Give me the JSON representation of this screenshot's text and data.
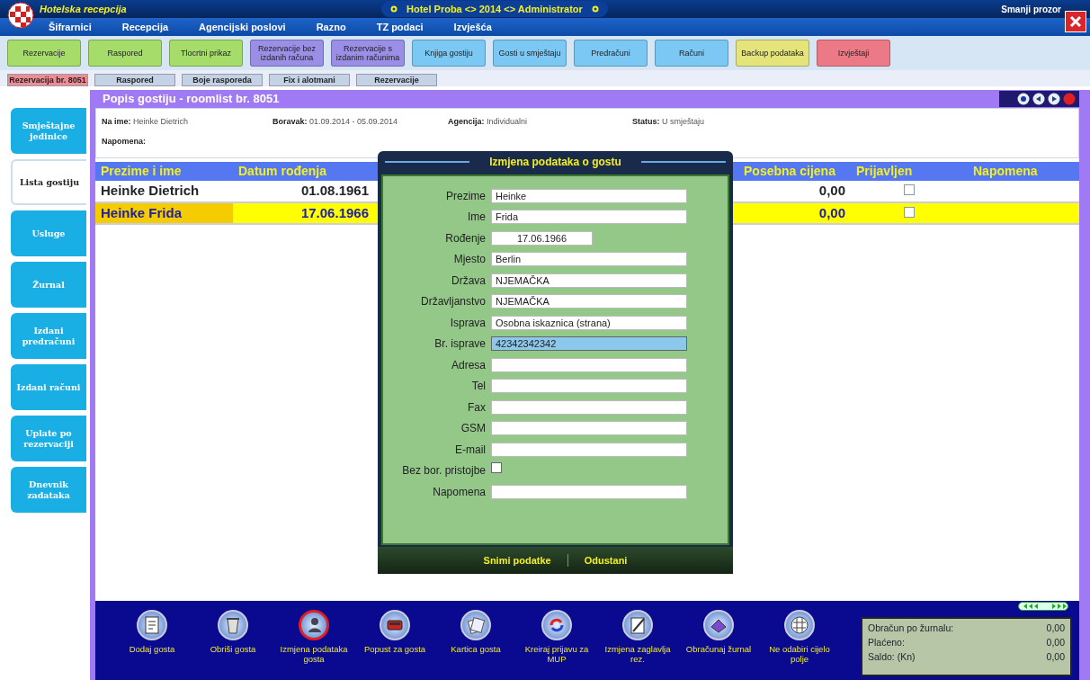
{
  "window": {
    "app_title": "Hotelska recepcija",
    "context": "Hotel Proba <> 2014 <> Administrator",
    "minimize": "Smanji prozor"
  },
  "menu": [
    "Šifrarnici",
    "Recepcija",
    "Agencijski poslovi",
    "Razno",
    "TZ podaci",
    "Izvješća"
  ],
  "toolbar": [
    {
      "label": "Rezervacije",
      "color": "#a6dc6a"
    },
    {
      "label": "Raspored",
      "color": "#a6dc6a"
    },
    {
      "label": "Tlocrtni prikaz",
      "color": "#a6dc6a"
    },
    {
      "label": "Rezervacije bez izdanih računa",
      "color": "#9a8ee6"
    },
    {
      "label": "Rezervacije s izdanim računima",
      "color": "#9a8ee6"
    },
    {
      "label": "Knjiga gostiju",
      "color": "#7cc8f4"
    },
    {
      "label": "Gosti u smještaju",
      "color": "#7cc8f4"
    },
    {
      "label": "Predračuni",
      "color": "#7cc8f4"
    },
    {
      "label": "Računi",
      "color": "#7cc8f4"
    },
    {
      "label": "Backup podataka",
      "color": "#e4e47a"
    },
    {
      "label": "Izvještaji",
      "color": "#ec7a86"
    }
  ],
  "tabs": [
    {
      "label": "Rezervacija br. 8051",
      "selected": true
    },
    {
      "label": "Raspored",
      "selected": false
    },
    {
      "label": "Boje rasporeda",
      "selected": false
    },
    {
      "label": "Fix i alotmani",
      "selected": false
    },
    {
      "label": "Rezervacije",
      "selected": false
    }
  ],
  "sidebar": {
    "items": [
      {
        "label": "Smještajne jedinice",
        "selected": false
      },
      {
        "label": "Lista gostiju",
        "selected": true
      },
      {
        "label": "Usluge",
        "selected": false
      },
      {
        "label": "Žurnal",
        "selected": false
      },
      {
        "label": "Izdani predračuni",
        "selected": false
      },
      {
        "label": "Izdani računi",
        "selected": false
      },
      {
        "label": "Uplate po rezervaciji",
        "selected": false
      },
      {
        "label": "Dnevnik zadataka",
        "selected": false
      }
    ]
  },
  "panel": {
    "title": "Popis gostiju - roomlist br. 8051",
    "info": [
      {
        "label": "Na ime:",
        "value": "Heinke Dietrich"
      },
      {
        "label": "Boravak:",
        "value": "01.09.2014 - 05.09.2014"
      },
      {
        "label": "Agencija:",
        "value": "Individualni"
      },
      {
        "label": "Status:",
        "value": "U smještaju"
      },
      {
        "label": "Napomena:"
      }
    ]
  },
  "table": {
    "columns": [
      "Prezime i ime",
      "Datum rođenja",
      "Posebna cijena",
      "Prijavljen",
      "Napomena"
    ],
    "rows": [
      {
        "name": "Heinke Dietrich",
        "birth_date": "01.08.1961",
        "special_price": "0,00",
        "registered": false,
        "selected": false
      },
      {
        "name": "Heinke Frida",
        "birth_date": "17.06.1966",
        "special_price": "0,00",
        "registered": false,
        "selected": true
      }
    ]
  },
  "dialog": {
    "title": "Izmjena podataka o gostu",
    "fields": [
      {
        "label": "Prezime",
        "kind": "text",
        "value": "Heinke",
        "focused": false
      },
      {
        "label": "Ime",
        "kind": "text",
        "value": "Frida",
        "focused": false
      },
      {
        "label": "Rođenje",
        "kind": "date",
        "value": "17.06.1966",
        "focused": false
      },
      {
        "label": "Mjesto",
        "kind": "text",
        "value": "Berlin",
        "focused": false
      },
      {
        "label": "Država",
        "kind": "text",
        "value": "NJEMAČKA",
        "focused": false
      },
      {
        "label": "Državljanstvo",
        "kind": "text",
        "value": "NJEMAČKA",
        "focused": false
      },
      {
        "label": "Isprava",
        "kind": "text",
        "value": "Osobna iskaznica (strana)",
        "focused": false
      },
      {
        "label": "Br. isprave",
        "kind": "text",
        "value": "42342342342",
        "focused": true
      },
      {
        "label": "Adresa",
        "kind": "text",
        "focused": false
      },
      {
        "label": "Tel",
        "kind": "text",
        "focused": false
      },
      {
        "label": "Fax",
        "kind": "text",
        "focused": false
      },
      {
        "label": "GSM",
        "kind": "text",
        "focused": false
      },
      {
        "label": "E-mail",
        "kind": "text",
        "focused": false
      },
      {
        "label": "Bez bor. pristojbe",
        "kind": "checkbox",
        "checked": false
      },
      {
        "label": "Napomena",
        "kind": "text",
        "focused": false
      }
    ],
    "buttons": [
      "Snimi podatke",
      "Odustani"
    ]
  },
  "actions": [
    {
      "label": "Dodaj gosta",
      "active": false
    },
    {
      "label": "Obriši gosta",
      "active": false
    },
    {
      "label": "Izmjena podataka gosta",
      "active": true
    },
    {
      "label": "Popust za gosta",
      "active": false
    },
    {
      "label": "Kartica gosta",
      "active": false
    },
    {
      "label": "Kreiraj prijavu za MUP",
      "active": false
    },
    {
      "label": "Izmjena zaglavlja rez.",
      "active": false
    },
    {
      "label": "Obračunaj žurnal",
      "active": false
    },
    {
      "label": "Ne odabiri cijelo polje",
      "active": false
    }
  ],
  "summary": [
    {
      "label": "Obračun po žurnalu:",
      "value": "0,00"
    },
    {
      "label": "Plaćeno:",
      "value": "0,00"
    },
    {
      "label": "Saldo: (Kn)",
      "value": "0,00"
    }
  ]
}
